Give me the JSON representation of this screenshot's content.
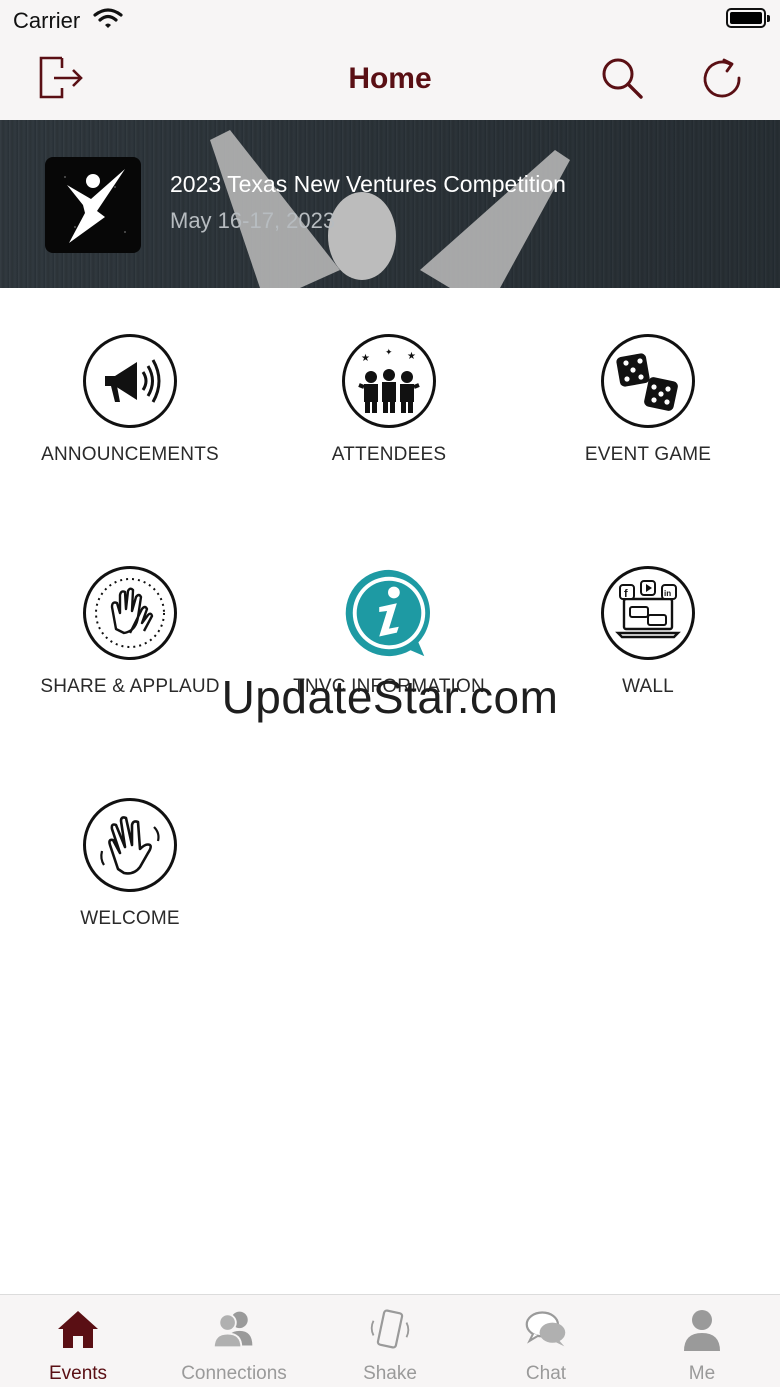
{
  "status_bar": {
    "carrier": "Carrier"
  },
  "nav": {
    "title": "Home",
    "logout_icon": "logout-icon",
    "search_icon": "search-icon",
    "refresh_icon": "refresh-icon"
  },
  "banner": {
    "event_title": "2023 Texas New Ventures Competition",
    "event_date": "May 16-17, 2023"
  },
  "grid": {
    "items": [
      {
        "label": "ANNOUNCEMENTS",
        "icon": "megaphone-icon"
      },
      {
        "label": "ATTENDEES",
        "icon": "people-celebrating-icon"
      },
      {
        "label": "EVENT GAME",
        "icon": "dice-icon"
      },
      {
        "label": "SHARE & APPLAUD",
        "icon": "clapping-hands-icon"
      },
      {
        "label": "TNVC INFORMATION",
        "icon": "info-icon"
      },
      {
        "label": "WALL",
        "icon": "social-wall-icon"
      },
      {
        "label": "WELCOME",
        "icon": "waving-hand-icon"
      }
    ]
  },
  "watermark": "UpdateStar.com",
  "tabs": [
    {
      "label": "Events",
      "icon": "home-icon",
      "active": true
    },
    {
      "label": "Connections",
      "icon": "connections-icon",
      "active": false
    },
    {
      "label": "Shake",
      "icon": "shake-phone-icon",
      "active": false
    },
    {
      "label": "Chat",
      "icon": "chat-icon",
      "active": false
    },
    {
      "label": "Me",
      "icon": "person-icon",
      "active": false
    }
  ],
  "colors": {
    "accent": "#5a0f14",
    "inactive_tab": "#9a9a9a",
    "info_teal": "#1e9aa3"
  }
}
